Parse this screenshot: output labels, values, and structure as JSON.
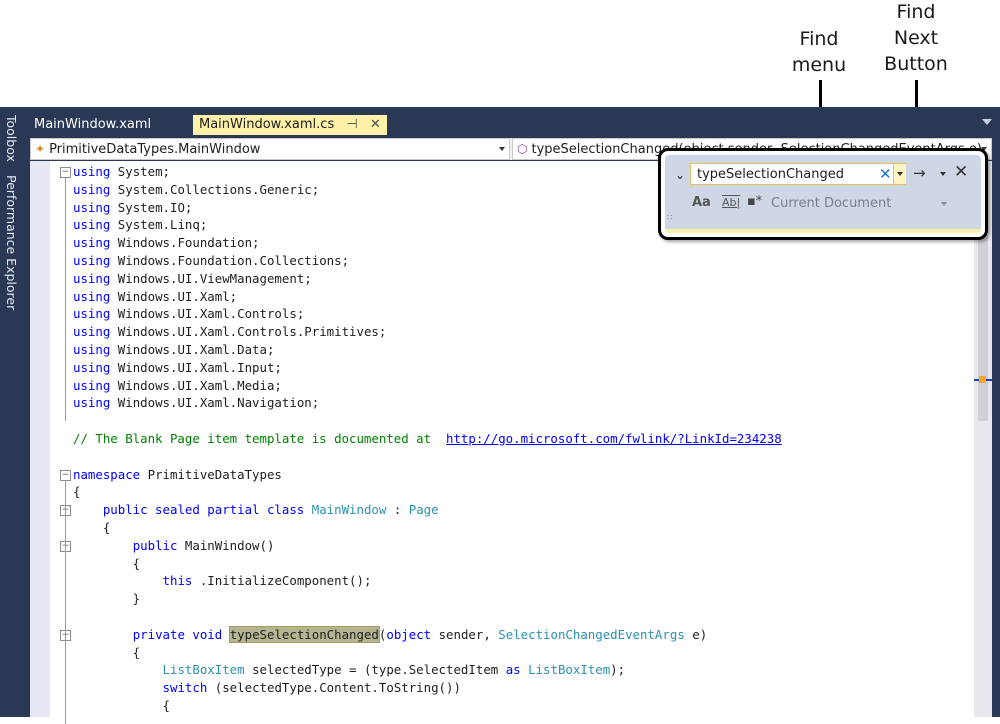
{
  "callouts": {
    "find_menu": "Find\nmenu",
    "find_next": "Find\nNext\nButton"
  },
  "sidebar": {
    "items": [
      {
        "label": "Toolbox"
      },
      {
        "label": "Performance Explorer"
      }
    ]
  },
  "tabs": [
    {
      "label": "MainWindow.xaml",
      "active": false
    },
    {
      "label": "MainWindow.xaml.cs",
      "active": true,
      "pin_icon": "⊣",
      "close_icon": "✕"
    }
  ],
  "navbar": {
    "type_selector": "PrimitiveDataTypes.MainWindow",
    "member_selector": "typeSelectionChanged(object sender, SelectionChangedEventArgs e)"
  },
  "find": {
    "value": "typeSelectionChanged",
    "placeholder": "",
    "clear_icon": "✕",
    "next_icon": "→",
    "close_icon": "✕",
    "expand_icon": "⌄",
    "match_case_label": "Aa",
    "whole_word_label": "Ab|",
    "regex_label": "▪*",
    "scope": "Current Document"
  },
  "code": {
    "lines": [
      {
        "tokens": [
          [
            "kw",
            "using"
          ],
          [
            "",
            "System;"
          ]
        ]
      },
      {
        "tokens": [
          [
            "kw",
            "using"
          ],
          [
            "",
            "System.Collections.Generic;"
          ]
        ]
      },
      {
        "tokens": [
          [
            "kw",
            "using"
          ],
          [
            "",
            "System.IO;"
          ]
        ]
      },
      {
        "tokens": [
          [
            "kw",
            "using"
          ],
          [
            "",
            "System.Linq;"
          ]
        ]
      },
      {
        "tokens": [
          [
            "kw",
            "using"
          ],
          [
            "",
            "Windows.Foundation;"
          ]
        ]
      },
      {
        "tokens": [
          [
            "kw",
            "using"
          ],
          [
            "",
            "Windows.Foundation.Collections;"
          ]
        ]
      },
      {
        "tokens": [
          [
            "kw",
            "using"
          ],
          [
            "",
            "Windows.UI.ViewManagement;"
          ]
        ]
      },
      {
        "tokens": [
          [
            "kw",
            "using"
          ],
          [
            "",
            "Windows.UI.Xaml;"
          ]
        ]
      },
      {
        "tokens": [
          [
            "kw",
            "using"
          ],
          [
            "",
            "Windows.UI.Xaml.Controls;"
          ]
        ]
      },
      {
        "tokens": [
          [
            "kw",
            "using"
          ],
          [
            "",
            "Windows.UI.Xaml.Controls.Primitives;"
          ]
        ]
      },
      {
        "tokens": [
          [
            "kw",
            "using"
          ],
          [
            "",
            "Windows.UI.Xaml.Data;"
          ]
        ]
      },
      {
        "tokens": [
          [
            "kw",
            "using"
          ],
          [
            "",
            "Windows.UI.Xaml.Input;"
          ]
        ]
      },
      {
        "tokens": [
          [
            "kw",
            "using"
          ],
          [
            "",
            "Windows.UI.Xaml.Media;"
          ]
        ]
      },
      {
        "tokens": [
          [
            "kw",
            "using"
          ],
          [
            "",
            "Windows.UI.Xaml.Navigation;"
          ]
        ]
      },
      {
        "tokens": []
      },
      {
        "tokens": [
          [
            "cm",
            "// The Blank Page item template is documented at "
          ],
          [
            "ln",
            "http://go.microsoft.com/fwlink/?LinkId=234238"
          ]
        ]
      },
      {
        "tokens": []
      },
      {
        "tokens": [
          [
            "kw",
            "namespace"
          ],
          [
            "",
            "PrimitiveDataTypes"
          ]
        ]
      },
      {
        "tokens": [
          [
            "",
            "{"
          ]
        ]
      },
      {
        "tokens": [
          [
            "",
            "    "
          ],
          [
            "kw",
            "public sealed partial class"
          ],
          [
            "ty",
            "MainWindow"
          ],
          [
            "",
            ":"
          ],
          [
            "ty",
            "Page"
          ]
        ]
      },
      {
        "tokens": [
          [
            "",
            "    {"
          ]
        ]
      },
      {
        "tokens": [
          [
            "",
            "        "
          ],
          [
            "kw",
            "public"
          ],
          [
            "",
            "MainWindow()"
          ]
        ]
      },
      {
        "tokens": [
          [
            "",
            "        {"
          ]
        ]
      },
      {
        "tokens": [
          [
            "",
            "            "
          ],
          [
            "kw",
            "this"
          ],
          [
            "",
            ".InitializeComponent();"
          ]
        ]
      },
      {
        "tokens": [
          [
            "",
            "        }"
          ]
        ]
      },
      {
        "tokens": []
      },
      {
        "tokens": [
          [
            "",
            "        "
          ],
          [
            "kw",
            "private void"
          ],
          [
            "hl",
            "typeSelectionChanged"
          ],
          [
            "",
            "("
          ],
          [
            "kw",
            "object"
          ],
          [
            "",
            "sender,"
          ],
          [
            "ty",
            "SelectionChangedEventArgs"
          ],
          [
            "",
            "e)"
          ]
        ]
      },
      {
        "tokens": [
          [
            "",
            "        {"
          ]
        ]
      },
      {
        "tokens": [
          [
            "",
            "            "
          ],
          [
            "ty",
            "ListBoxItem"
          ],
          [
            "",
            "selectedType = (type.SelectedItem"
          ],
          [
            "kw",
            "as"
          ],
          [
            "ty",
            "ListBoxItem"
          ],
          [
            "",
            ");"
          ]
        ]
      },
      {
        "tokens": [
          [
            "",
            "            "
          ],
          [
            "kw",
            "switch"
          ],
          [
            "",
            "(selectedType.Content.ToString())"
          ]
        ]
      },
      {
        "tokens": [
          [
            "",
            "            {"
          ]
        ]
      }
    ]
  }
}
